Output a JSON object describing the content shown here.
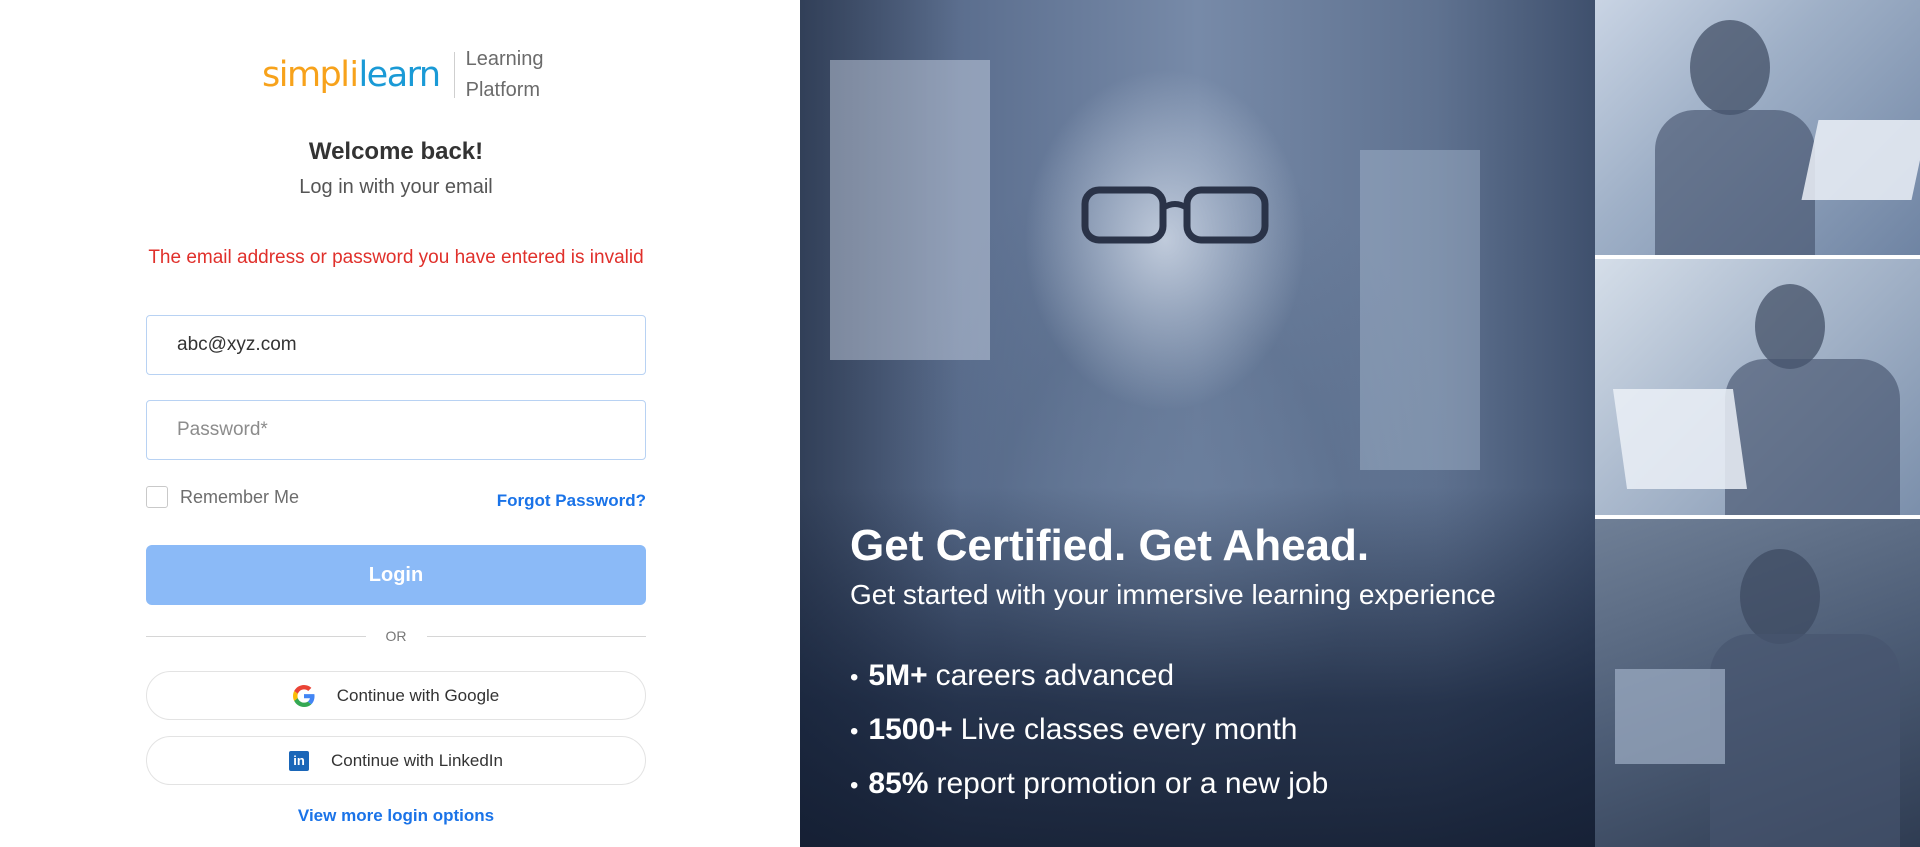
{
  "brand": {
    "logo_simpl": "simpl",
    "logo_bar": "i",
    "logo_learn": "learn",
    "tagline_line1": "Learning",
    "tagline_line2": "Platform",
    "colors": {
      "orange": "#f7a21b",
      "blue": "#1a9ad6"
    }
  },
  "login": {
    "title": "Welcome back!",
    "subtitle": "Log in with your email",
    "error": "The email address or password you have entered is invalid",
    "email_value": "abc@xyz.com",
    "password_placeholder": "Password*",
    "remember_label": "Remember Me",
    "remember_checked": false,
    "forgot_label": "Forgot Password?",
    "login_label": "Login",
    "or_label": "OR",
    "google_label": "Continue with Google",
    "linkedin_label": "Continue with LinkedIn",
    "more_options_label": "View more login options"
  },
  "hero": {
    "title": "Get Certified. Get Ahead.",
    "subtitle": "Get started with your immersive learning experience",
    "stats": [
      {
        "num": "5M+",
        "text": "careers advanced"
      },
      {
        "num": "1500+",
        "text": "Live classes every month"
      },
      {
        "num": "85%",
        "text": "report promotion or a new job"
      }
    ]
  },
  "icons": {
    "google": "google-icon",
    "linkedin": "linkedin-icon",
    "linkedin_glyph": "in"
  },
  "colors": {
    "error": "#e0302b",
    "link": "#1a73e8",
    "login_button": "#8bbaf7"
  }
}
